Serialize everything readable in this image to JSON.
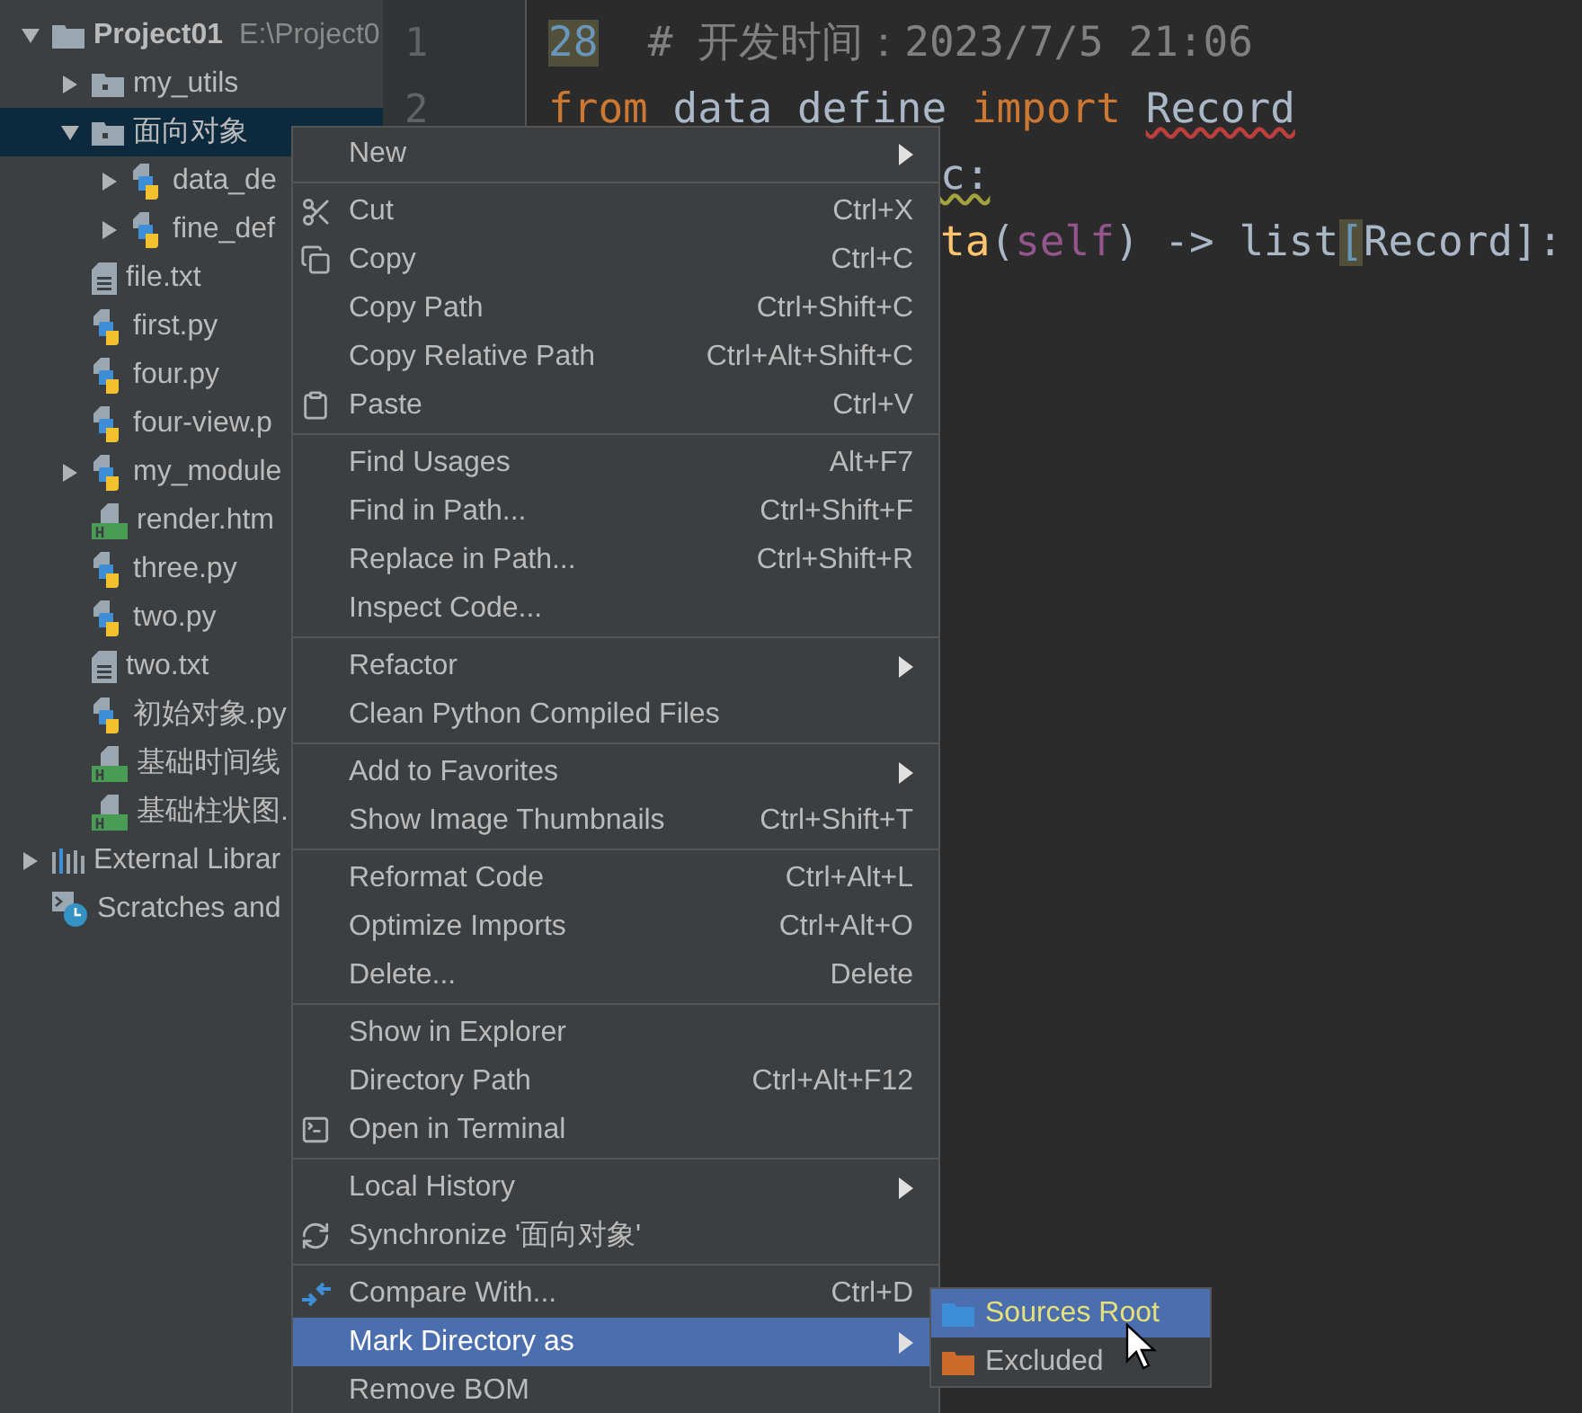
{
  "project_tree": {
    "items": [
      {
        "label": "Project01",
        "path": "E:\\Project0",
        "kind": "folder",
        "expanded": true,
        "selected": false,
        "children": [
          {
            "label": "my_utils",
            "kind": "module-folder",
            "expanded": false,
            "selected": false
          },
          {
            "label": "面向对象",
            "kind": "module-folder",
            "expanded": true,
            "selected": true,
            "children": [
              {
                "label": "data_de",
                "kind": "python",
                "expanded": false,
                "selected": false
              },
              {
                "label": "fine_def",
                "kind": "python",
                "expanded": false,
                "selected": false
              }
            ]
          },
          {
            "label": "file.txt",
            "kind": "text",
            "selected": false
          },
          {
            "label": "first.py",
            "kind": "python",
            "selected": false
          },
          {
            "label": "four.py",
            "kind": "python",
            "selected": false
          },
          {
            "label": "four-view.p",
            "kind": "python",
            "selected": false
          },
          {
            "label": "my_module",
            "kind": "python",
            "expanded": false,
            "selected": false
          },
          {
            "label": "render.htm",
            "kind": "html",
            "selected": false
          },
          {
            "label": "three.py",
            "kind": "python",
            "selected": false
          },
          {
            "label": "two.py",
            "kind": "python",
            "selected": false
          },
          {
            "label": "two.txt",
            "kind": "text",
            "selected": false
          },
          {
            "label": "初始对象.py",
            "kind": "python",
            "selected": false
          },
          {
            "label": "基础时间线",
            "kind": "html",
            "selected": false
          },
          {
            "label": "基础柱状图.",
            "kind": "html",
            "selected": false
          }
        ]
      },
      {
        "label": "External Librar",
        "kind": "libraries",
        "expanded": false,
        "selected": false
      },
      {
        "label": "Scratches and",
        "kind": "scratches",
        "selected": false
      }
    ]
  },
  "editor": {
    "line_numbers": [
      "1",
      "2"
    ],
    "lines": [
      {
        "covered": false,
        "tokens": [
          {
            "text": "28",
            "kind": "marked"
          },
          {
            "text": "  # 开发时间：2023/7/5 21:06",
            "kind": "comment"
          }
        ]
      },
      {
        "covered": false,
        "tokens": [
          {
            "text": "from",
            "kind": "keyword"
          },
          {
            "text": " data define ",
            "kind": "name"
          },
          {
            "text": "import",
            "kind": "keyword"
          },
          {
            "text": "Record",
            "kind": "error"
          }
        ]
      },
      {
        "covered": true,
        "tokens": [
          {
            "text": "c:",
            "kind": "warning"
          }
        ]
      },
      {
        "covered": true,
        "tokens": [
          {
            "text": "ta",
            "kind": "function"
          },
          {
            "text": "(",
            "kind": "name"
          },
          {
            "text": "self",
            "kind": "self"
          },
          {
            "text": ") -> list",
            "kind": "name"
          },
          {
            "text": "[",
            "kind": "marked"
          },
          {
            "text": "Record]:",
            "kind": "name"
          }
        ]
      }
    ]
  },
  "context_menu": {
    "groups": [
      [
        {
          "label": "New",
          "submenu": true,
          "selected": false
        }
      ],
      [
        {
          "label": "Cut",
          "shortcut": "Ctrl+X",
          "selected": false
        },
        {
          "label": "Copy",
          "shortcut": "Ctrl+C",
          "selected": false
        },
        {
          "label": "Copy Path",
          "shortcut": "Ctrl+Shift+C",
          "selected": false
        },
        {
          "label": "Copy Relative Path",
          "shortcut": "Ctrl+Alt+Shift+C",
          "selected": false
        },
        {
          "label": "Paste",
          "shortcut": "Ctrl+V",
          "selected": false
        }
      ],
      [
        {
          "label": "Find Usages",
          "shortcut": "Alt+F7",
          "selected": false
        },
        {
          "label": "Find in Path...",
          "shortcut": "Ctrl+Shift+F",
          "selected": false
        },
        {
          "label": "Replace in Path...",
          "shortcut": "Ctrl+Shift+R",
          "selected": false
        },
        {
          "label": "Inspect Code...",
          "selected": false
        }
      ],
      [
        {
          "label": "Refactor",
          "submenu": true,
          "selected": false
        },
        {
          "label": "Clean Python Compiled Files",
          "selected": false
        }
      ],
      [
        {
          "label": "Add to Favorites",
          "submenu": true,
          "selected": false
        },
        {
          "label": "Show Image Thumbnails",
          "shortcut": "Ctrl+Shift+T",
          "selected": false
        }
      ],
      [
        {
          "label": "Reformat Code",
          "shortcut": "Ctrl+Alt+L",
          "selected": false
        },
        {
          "label": "Optimize Imports",
          "shortcut": "Ctrl+Alt+O",
          "selected": false
        },
        {
          "label": "Delete...",
          "shortcut": "Delete",
          "selected": false
        }
      ],
      [
        {
          "label": "Show in Explorer",
          "selected": false
        },
        {
          "label": "Directory Path",
          "shortcut": "Ctrl+Alt+F12",
          "selected": false
        },
        {
          "label": "Open in Terminal",
          "selected": false
        }
      ],
      [
        {
          "label": "Local History",
          "submenu": true,
          "selected": false
        },
        {
          "label": "Synchronize '面向对象'",
          "selected": false
        }
      ],
      [
        {
          "label": "Compare With...",
          "shortcut": "Ctrl+D",
          "selected": false
        },
        {
          "label": "Mark Directory as",
          "submenu": true,
          "selected": true
        },
        {
          "label": "Remove BOM",
          "selected": false
        }
      ]
    ]
  },
  "submenu": {
    "items": [
      {
        "label": "Sources Root",
        "color": "#3d8ed6",
        "selected": true
      },
      {
        "label": "Excluded",
        "color": "#cc6a2c",
        "selected": false
      }
    ]
  }
}
